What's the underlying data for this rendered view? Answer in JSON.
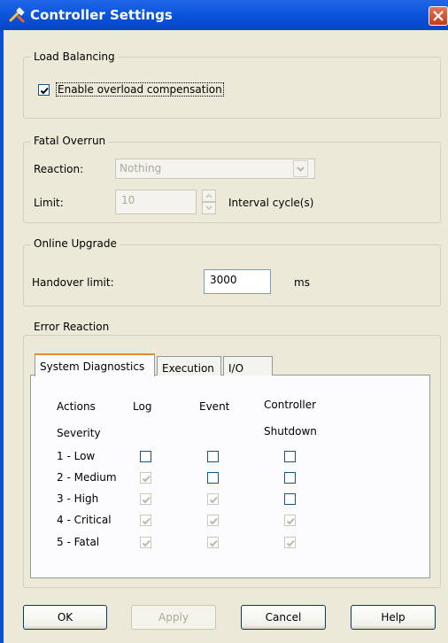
{
  "window": {
    "title": "Controller Settings",
    "icon": "wrench-tool-icon",
    "close_icon": "close-icon"
  },
  "load_balancing": {
    "legend": "Load Balancing",
    "checkbox_label": "Enable overload compensation",
    "checked": true
  },
  "fatal_overrun": {
    "legend": "Fatal Overrun",
    "reaction_label": "Reaction:",
    "reaction_value": "Nothing",
    "limit_label": "Limit:",
    "limit_value": "10",
    "limit_unit": "Interval cycle(s)"
  },
  "online_upgrade": {
    "legend": "Online Upgrade",
    "handover_label": "Handover limit:",
    "handover_value": "3000",
    "handover_unit": "ms"
  },
  "error_reaction": {
    "legend": "Error Reaction",
    "tabs": [
      "System Diagnostics",
      "Execution",
      "I/O"
    ],
    "active_tab": "System Diagnostics",
    "headers": {
      "actions": "Actions",
      "log": "Log",
      "event": "Event",
      "controller": "Controller",
      "severity": "Severity",
      "shutdown": "Shutdown"
    },
    "rows": [
      {
        "label": "1 - Low",
        "log": false,
        "event": false,
        "shutdown": false
      },
      {
        "label": "2 - Medium",
        "log": true,
        "event": false,
        "shutdown": false
      },
      {
        "label": "3 - High",
        "log": true,
        "event": true,
        "shutdown": false
      },
      {
        "label": "4 - Critical",
        "log": true,
        "event": true,
        "shutdown": true
      },
      {
        "label": "5 - Fatal",
        "log": true,
        "event": true,
        "shutdown": true
      }
    ]
  },
  "buttons": {
    "ok": "OK",
    "apply": "Apply",
    "cancel": "Cancel",
    "help": "Help"
  },
  "colors": {
    "titlebar": "#0A52D9",
    "dialog_bg": "#ECE9D8",
    "tab_highlight": "#E68B2C"
  }
}
